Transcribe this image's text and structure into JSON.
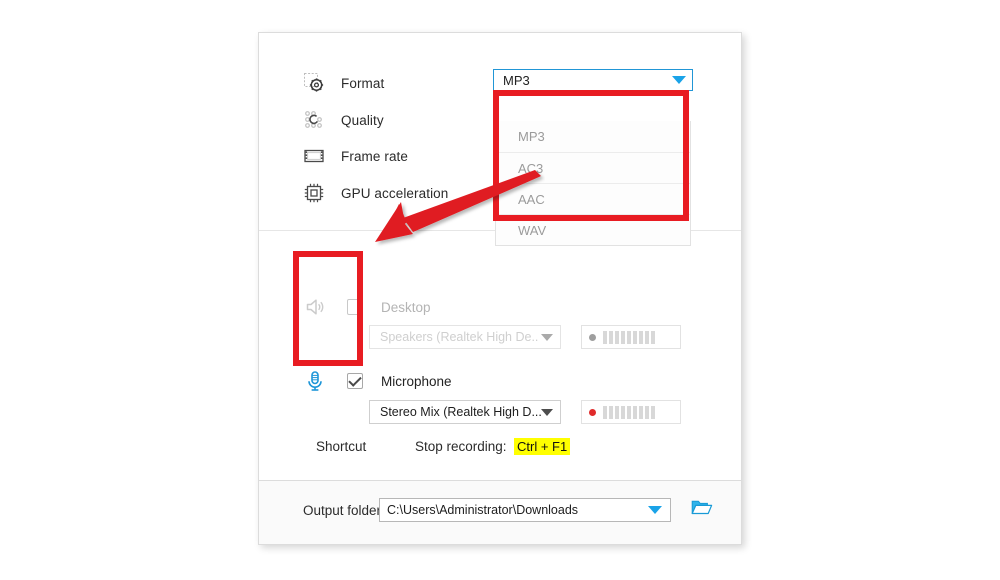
{
  "panel": {
    "options": [
      {
        "icon": "format-icon",
        "label": "Format"
      },
      {
        "icon": "quality-icon",
        "label": "Quality"
      },
      {
        "icon": "frame-rate-icon",
        "label": "Frame rate"
      },
      {
        "icon": "gpu-acceleration-icon",
        "label": "GPU acceleration"
      }
    ],
    "format_select": {
      "value": "MP3",
      "options": [
        "MP3",
        "AC3",
        "AAC",
        "WAV"
      ],
      "border_color": "#2196d6",
      "arrow_color": "#1aa3e8"
    },
    "audio": {
      "desktop": {
        "label": "Desktop",
        "checked": false,
        "enabled": false,
        "icon": "speaker-icon",
        "device": "Speakers (Realtek High De..",
        "meter_dot_color": "#9e9e9e",
        "meter_bars": 9
      },
      "microphone": {
        "label": "Microphone",
        "checked": true,
        "enabled": true,
        "icon": "microphone-icon",
        "device": "Stereo Mix (Realtek High D...",
        "meter_dot_color": "#e02b2b",
        "meter_bars": 9
      }
    },
    "shortcut": {
      "label": "Shortcut",
      "stop_recording_label": "Stop recording:",
      "stop_recording_key": "Ctrl + F1",
      "highlight_color": "#ffff00"
    },
    "output": {
      "label": "Output folder:",
      "path": "C:\\Users\\Administrator\\Downloads",
      "browse_icon": "folder-open-icon"
    }
  },
  "annotations": {
    "color": "#e81c22",
    "dropdown_box": "highlights the open format list",
    "audio_box": "highlights the desktop and microphone toggles",
    "arrow": "arrow-annotation"
  }
}
